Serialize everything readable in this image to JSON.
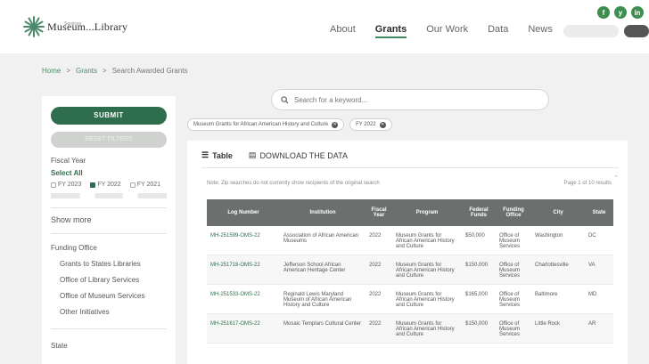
{
  "header": {
    "logo_text": "Museum...Library",
    "logo_subtext": "Services",
    "nav": [
      {
        "label": "About",
        "active": false
      },
      {
        "label": "Grants",
        "active": true
      },
      {
        "label": "Our Work",
        "active": false
      },
      {
        "label": "Data",
        "active": false
      },
      {
        "label": "News",
        "active": false
      }
    ],
    "social": [
      "f",
      "y",
      "in"
    ]
  },
  "breadcrumb": {
    "home": "Home",
    "sep": ">",
    "grants": "Grants",
    "current": "Search Awarded Grants"
  },
  "search": {
    "placeholder": "Search for a keyword..."
  },
  "sidebar": {
    "submit": "SUBMIT",
    "reset": "RESET FILTERS",
    "fiscal_year_label": "Fiscal Year",
    "select_all": "Select All",
    "years": [
      {
        "label": "FY 2023",
        "checked": false
      },
      {
        "label": "FY 2022",
        "checked": true
      },
      {
        "label": "FY 2021",
        "checked": false
      }
    ],
    "show_more": "Show more",
    "funding_office_label": "Funding Office",
    "funding_offices": [
      "Grants to States Libraries",
      "Office of Library Services",
      "Office of Museum Services",
      "Other Initiatives"
    ],
    "state_label": "State"
  },
  "filters": {
    "chips": [
      "Museum Grants for African American History and Culture",
      "FY 2022"
    ]
  },
  "results": {
    "tab_table": "Table",
    "tab_download": "DOWNLOAD THE DATA",
    "note": "Note: Zip searches do not currently show recipients of the original search",
    "page_count": "Page 1 of 10 results",
    "columns": [
      "Log Number",
      "Institution",
      "Fiscal Year",
      "Program",
      "Federal Funds",
      "Funding Office",
      "City",
      "State"
    ],
    "rows": [
      {
        "log": "MH-251599-OMS-22",
        "institution": "Association of African American Museums",
        "year": "2022",
        "program": "Museum Grants for African American History and Culture",
        "funds": "$50,000",
        "office": "Office of Museum Services",
        "city": "Washington",
        "state": "DC"
      },
      {
        "log": "MH-251718-OMS-22",
        "institution": "Jefferson School African American Heritage Center",
        "year": "2022",
        "program": "Museum Grants for African American History and Culture",
        "funds": "$150,000",
        "office": "Office of Museum Services",
        "city": "Charlottesville",
        "state": "VA"
      },
      {
        "log": "MH-251533-OMS-22",
        "institution": "Reginald Lewis Maryland Museum of African American History and Culture",
        "year": "2022",
        "program": "Museum Grants for African American History and Culture",
        "funds": "$165,000",
        "office": "Office of Museum Services",
        "city": "Baltimore",
        "state": "MD"
      },
      {
        "log": "MH-251617-OMS-22",
        "institution": "Mosaic Templars Cultural Center",
        "year": "2022",
        "program": "Museum Grants for African American History and Culture",
        "funds": "$150,000",
        "office": "Office of Museum Services",
        "city": "Little Rock",
        "state": "AR"
      }
    ]
  },
  "colors": {
    "accent": "#2f6e4c",
    "table_header": "#6b6f6d",
    "social": "#3e8f4f"
  }
}
